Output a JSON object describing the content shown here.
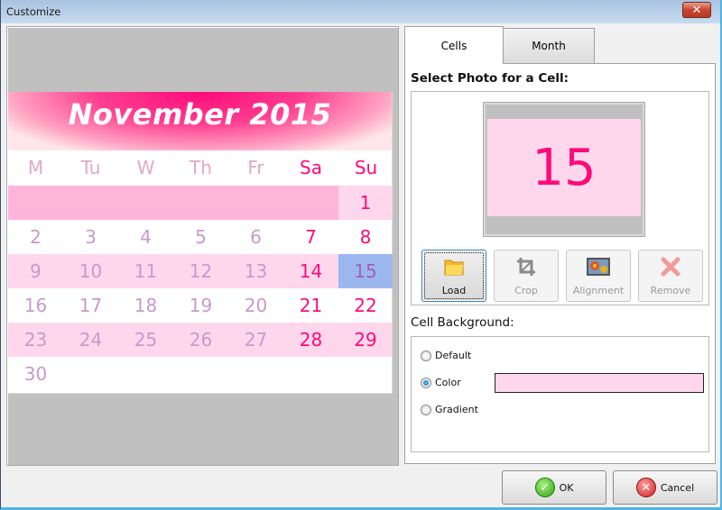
{
  "window": {
    "title": "Customize",
    "close_symbol": "✕"
  },
  "calendar": {
    "title": "November 2015",
    "days_of_week": [
      {
        "label": "M",
        "weekend": false
      },
      {
        "label": "Tu",
        "weekend": false
      },
      {
        "label": "W",
        "weekend": false
      },
      {
        "label": "Th",
        "weekend": false
      },
      {
        "label": "Fr",
        "weekend": false
      },
      {
        "label": "Sa",
        "weekend": true
      },
      {
        "label": "Su",
        "weekend": true
      }
    ],
    "weeks": [
      [
        "",
        "",
        "",
        "",
        "",
        "",
        "1"
      ],
      [
        "2",
        "3",
        "4",
        "5",
        "6",
        "7",
        "8"
      ],
      [
        "9",
        "10",
        "11",
        "12",
        "13",
        "14",
        "15"
      ],
      [
        "16",
        "17",
        "18",
        "19",
        "20",
        "21",
        "22"
      ],
      [
        "23",
        "24",
        "25",
        "26",
        "27",
        "28",
        "29"
      ],
      [
        "30",
        "",
        "",
        "",
        "",
        "",
        ""
      ]
    ],
    "selected_day": "15",
    "colors": {
      "weekend": "#ff0a7a",
      "weekday": "#c79acb",
      "band_light": "#ffd7ec",
      "band_strong": "#ffb4da",
      "selected": "#9cb7f0"
    }
  },
  "tabs": [
    {
      "label": "Cells",
      "active": true
    },
    {
      "label": "Month",
      "active": false
    }
  ],
  "cells_panel": {
    "select_photo_title": "Select Photo for a Cell:",
    "photo_preview_number": "15",
    "tool_buttons": [
      {
        "label": "Load",
        "icon": "folder-icon",
        "enabled": true
      },
      {
        "label": "Crop",
        "icon": "crop-icon",
        "enabled": false
      },
      {
        "label": "Alignment",
        "icon": "image-icon",
        "enabled": false
      },
      {
        "label": "Remove",
        "icon": "remove-x-icon",
        "enabled": false
      }
    ],
    "background_title": "Cell Background:",
    "background_options": [
      {
        "label": "Default",
        "checked": false
      },
      {
        "label": "Color",
        "checked": true
      },
      {
        "label": "Gradient",
        "checked": false
      }
    ],
    "color_value": "#ffd7ec"
  },
  "dialog_buttons": {
    "ok": "OK",
    "cancel": "Cancel"
  }
}
